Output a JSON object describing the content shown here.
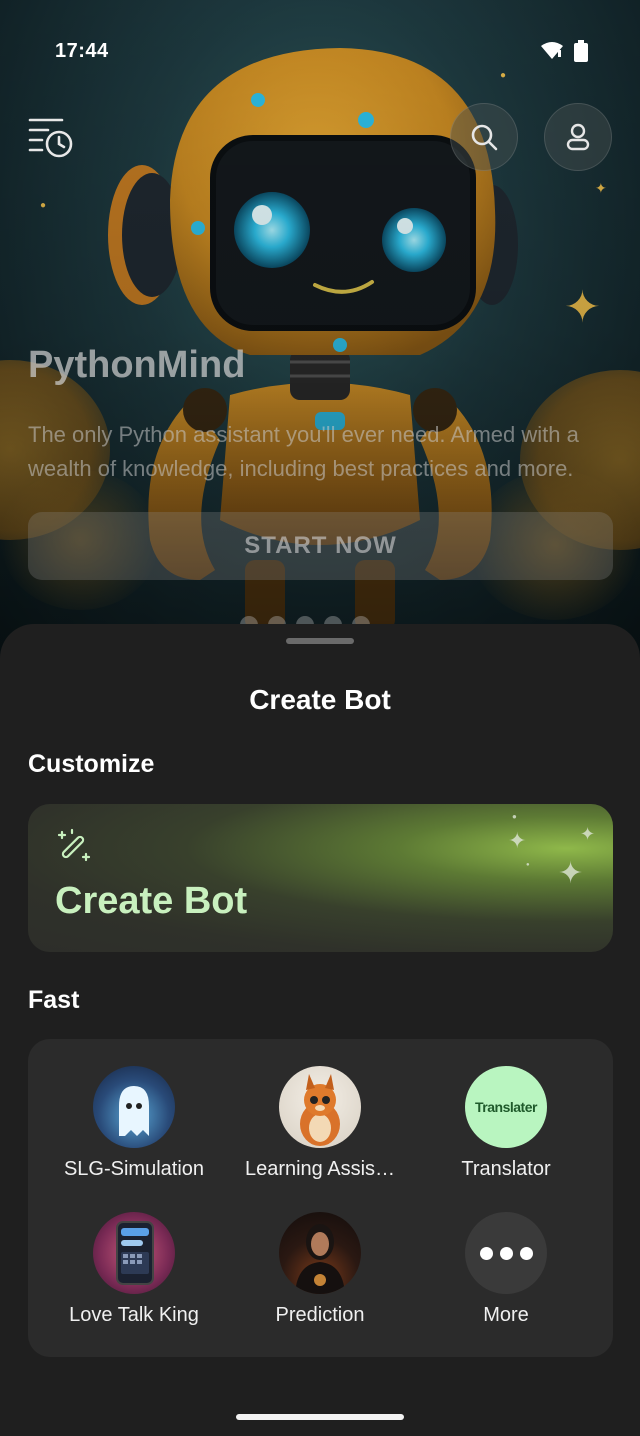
{
  "status_bar": {
    "time": "17:44"
  },
  "hero": {
    "title": "PythonMind",
    "description": "The only Python assistant you'll ever need. Armed with a wealth of knowledge, including best practices and more.",
    "start_label": "START NOW",
    "page_count": 5
  },
  "sheet": {
    "title": "Create Bot",
    "customize_label": "Customize",
    "create_card_title": "Create Bot",
    "fast_label": "Fast",
    "bots": [
      {
        "name": "SLG-Simulation",
        "icon": "ghost-avatar"
      },
      {
        "name": "Learning Assis…",
        "icon": "squirrel-avatar"
      },
      {
        "name": "Translator",
        "icon": "translator-logo",
        "logo_text": "Translater"
      },
      {
        "name": "Love Talk King",
        "icon": "phone-chat-avatar"
      },
      {
        "name": "Prediction",
        "icon": "fortune-teller-avatar"
      },
      {
        "name": "More",
        "icon": "more-dots-icon"
      }
    ]
  },
  "colors": {
    "sheet_bg": "#1f1f1f",
    "card_bg": "#2b2b2b",
    "accent_green": "#c8f0be",
    "translator_bg": "#b9f5c0"
  }
}
